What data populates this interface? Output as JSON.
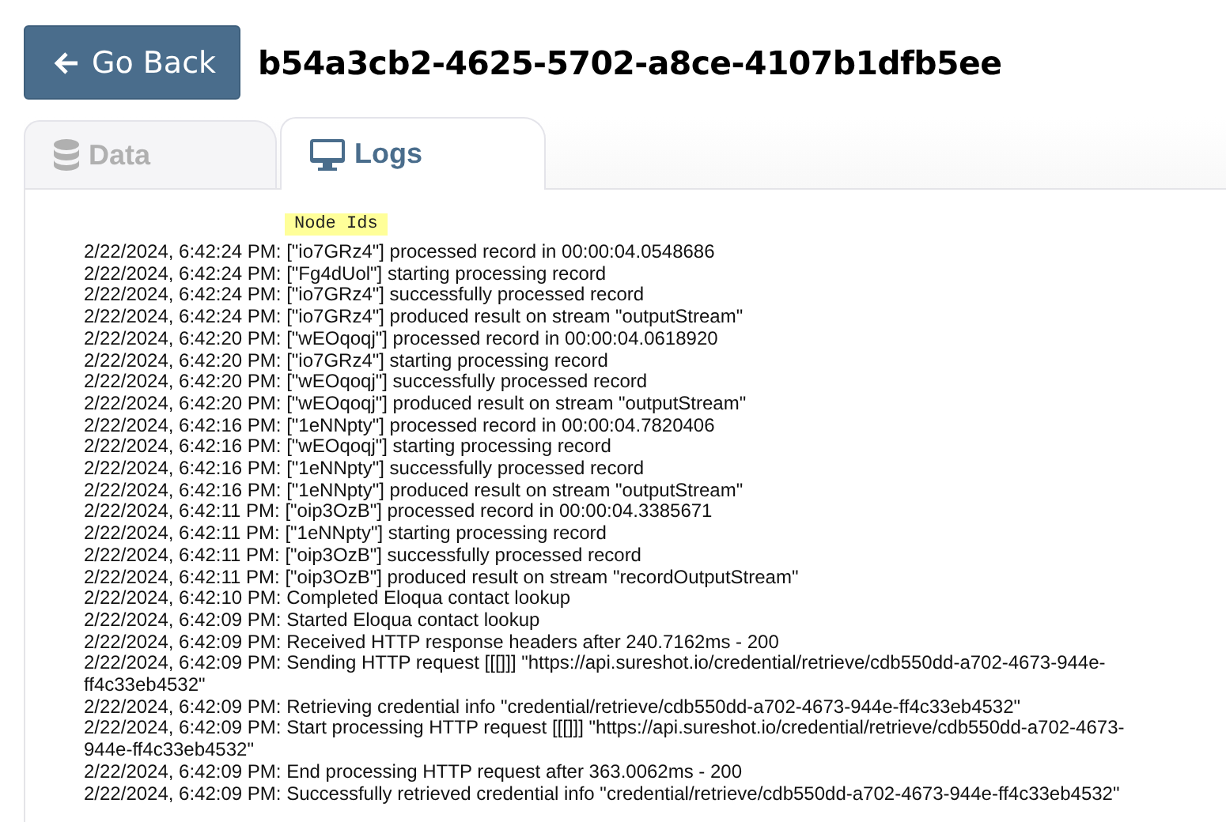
{
  "back_button": {
    "label": "Go Back"
  },
  "title": "b54a3cb2-4625-5702-a8ce-4107b1dfb5ee",
  "tabs": [
    {
      "label": "Data",
      "kind": "database",
      "selected": false
    },
    {
      "label": "Logs",
      "kind": "monitor",
      "selected": true
    }
  ],
  "node_ids_badge": "Node Ids",
  "log_lines": [
    "2/22/2024, 6:42:24 PM: [\"io7GRz4\"] processed record in 00:00:04.0548686",
    "2/22/2024, 6:42:24 PM: [\"Fg4dUol\"] starting processing record",
    "2/22/2024, 6:42:24 PM: [\"io7GRz4\"] successfully processed record",
    "2/22/2024, 6:42:24 PM: [\"io7GRz4\"] produced result on stream \"outputStream\"",
    "2/22/2024, 6:42:20 PM: [\"wEOqoqj\"] processed record in 00:00:04.0618920",
    "2/22/2024, 6:42:20 PM: [\"io7GRz4\"] starting processing record",
    "2/22/2024, 6:42:20 PM: [\"wEOqoqj\"] successfully processed record",
    "2/22/2024, 6:42:20 PM: [\"wEOqoqj\"] produced result on stream \"outputStream\"",
    "2/22/2024, 6:42:16 PM: [\"1eNNpty\"] processed record in 00:00:04.7820406",
    "2/22/2024, 6:42:16 PM: [\"wEOqoqj\"] starting processing record",
    "2/22/2024, 6:42:16 PM: [\"1eNNpty\"] successfully processed record",
    "2/22/2024, 6:42:16 PM: [\"1eNNpty\"] produced result on stream \"outputStream\"",
    "2/22/2024, 6:42:11 PM: [\"oip3OzB\"] processed record in 00:00:04.3385671",
    "2/22/2024, 6:42:11 PM: [\"1eNNpty\"] starting processing record",
    "2/22/2024, 6:42:11 PM: [\"oip3OzB\"] successfully processed record",
    "2/22/2024, 6:42:11 PM: [\"oip3OzB\"] produced result on stream \"recordOutputStream\"",
    "2/22/2024, 6:42:10 PM: Completed Eloqua contact lookup",
    "2/22/2024, 6:42:09 PM: Started Eloqua contact lookup",
    "2/22/2024, 6:42:09 PM: Received HTTP response headers after 240.7162ms - 200",
    "2/22/2024, 6:42:09 PM: Sending HTTP request [[[]]] \"https://api.sureshot.io/credential/retrieve/cdb550dd-a702-4673-944e-ff4c33eb4532\"",
    "2/22/2024, 6:42:09 PM: Retrieving credential info \"credential/retrieve/cdb550dd-a702-4673-944e-ff4c33eb4532\"",
    "2/22/2024, 6:42:09 PM: Start processing HTTP request [[[]]] \"https://api.sureshot.io/credential/retrieve/cdb550dd-a702-4673-944e-ff4c33eb4532\"",
    "2/22/2024, 6:42:09 PM: End processing HTTP request after 363.0062ms - 200",
    "2/22/2024, 6:42:09 PM: Successfully retrieved credential info \"credential/retrieve/cdb550dd-a702-4673-944e-ff4c33eb4532\""
  ]
}
